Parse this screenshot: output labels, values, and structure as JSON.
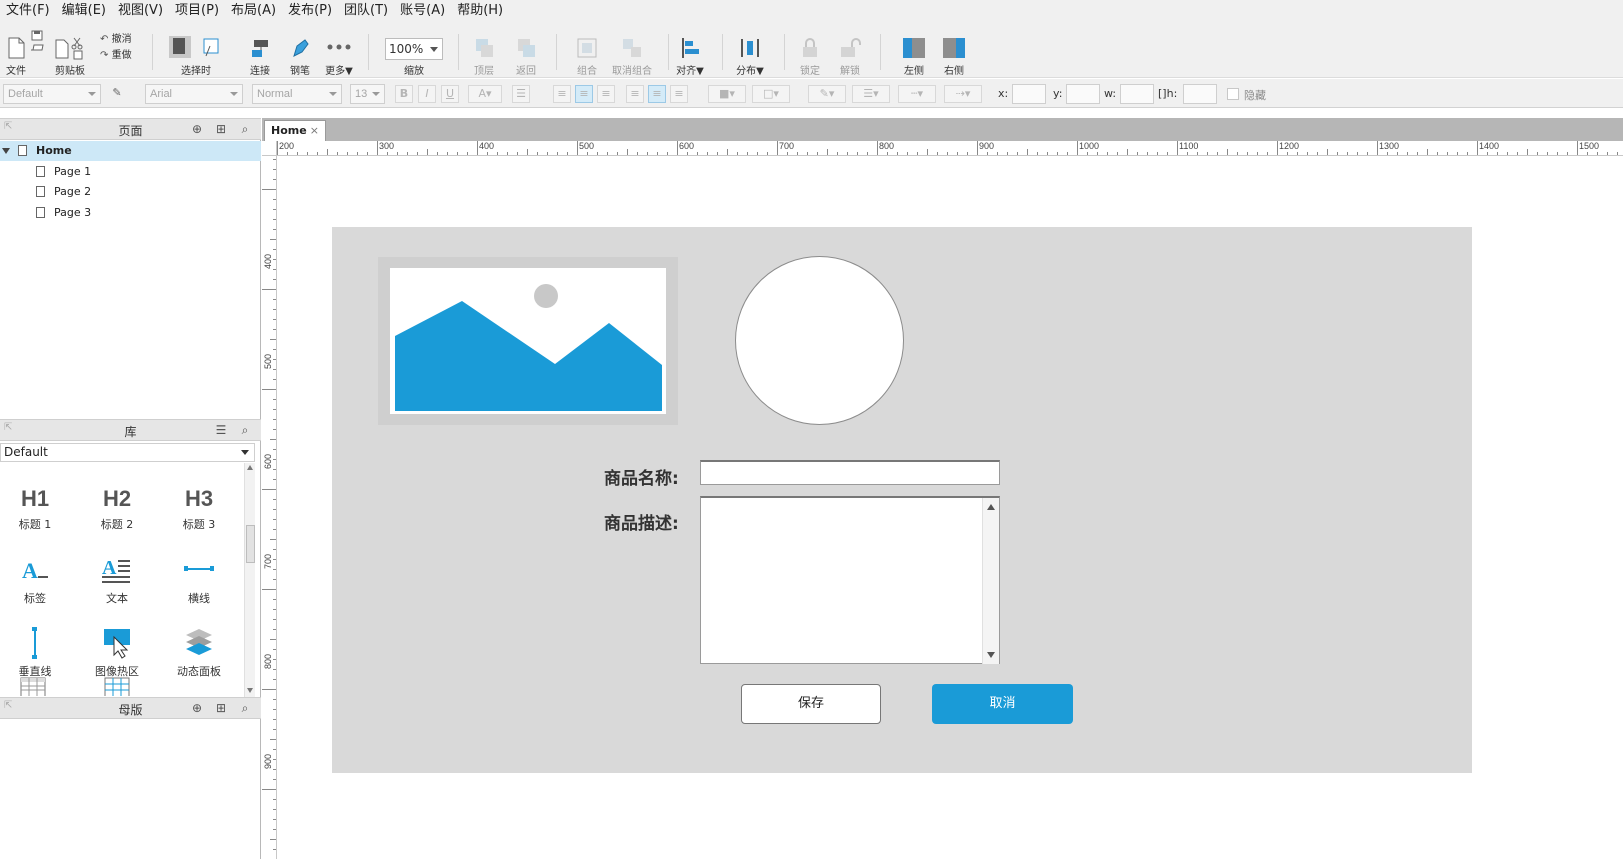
{
  "menu": [
    "文件(F)",
    "编辑(E)",
    "视图(V)",
    "项目(P)",
    "布局(A)",
    "发布(P)",
    "团队(T)",
    "账号(A)",
    "帮助(H)"
  ],
  "toolbar": {
    "file_label": "文件",
    "clipboard_label": "剪贴板",
    "undo_label": "撤消",
    "redo_label": "重做",
    "select_label": "选择时",
    "connect_label": "连接",
    "pen_label": "钢笔",
    "more_label": "更多▼",
    "zoom_value": "100%",
    "zoom_label": "缩放",
    "top_label": "顶层",
    "back_label": "返回",
    "group_label": "组合",
    "ungroup_label": "取消组合",
    "align_label": "对齐▼",
    "distribute_label": "分布▼",
    "lock_label": "锁定",
    "unlock_label": "解锁",
    "left_label": "左侧",
    "right_label": "右侧"
  },
  "formatbar": {
    "style": "Default",
    "font": "Arial",
    "weight": "Normal",
    "size": "13",
    "x_label": "x:",
    "y_label": "y:",
    "w_label": "w:",
    "h_label": "h:",
    "hide_label": "隐藏"
  },
  "pages_panel": {
    "title": "页面",
    "home": "Home",
    "pages": [
      "Page 1",
      "Page 2",
      "Page 3"
    ]
  },
  "library_panel": {
    "title": "库",
    "selected": "Default",
    "widgets": {
      "h1_glyph": "H1",
      "h1": "标题 1",
      "h2_glyph": "H2",
      "h2": "标题 2",
      "h3_glyph": "H3",
      "h3": "标题 3",
      "label": "标签",
      "text": "文本",
      "hline": "横线",
      "vline": "垂直线",
      "hotspot": "图像热区",
      "dynamic_panel": "动态面板"
    }
  },
  "masters_panel": {
    "title": "母版"
  },
  "canvas": {
    "tab": "Home",
    "tab_close": "×",
    "hruler": [
      "200",
      "300",
      "400",
      "500",
      "600",
      "700",
      "800",
      "900",
      "1000",
      "1100",
      "1200",
      "1300",
      "1400",
      "1500"
    ],
    "vruler": [
      "400",
      "500",
      "600",
      "700",
      "800",
      "900"
    ]
  },
  "form": {
    "name_label": "商品名称:",
    "desc_label": "商品描述:",
    "save": "保存",
    "cancel": "取消"
  },
  "colors": {
    "accent": "#1a9bd7",
    "frame": "#d9d9d9",
    "selected_row": "#cde8f7"
  }
}
